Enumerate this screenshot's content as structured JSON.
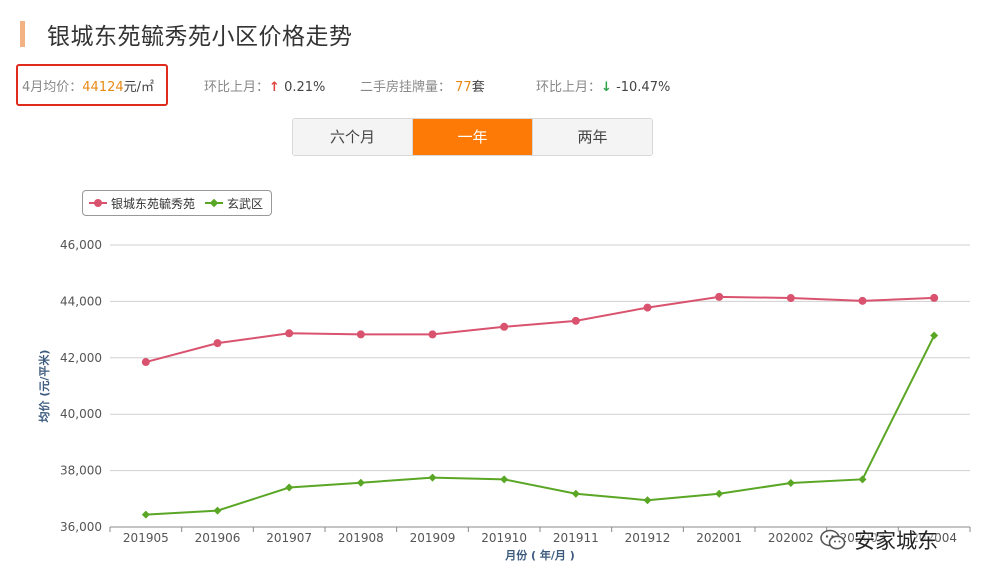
{
  "header": {
    "title": "银城东苑毓秀苑小区价格走势"
  },
  "stats": {
    "avg_label": "4月均价：",
    "avg_value": "44124",
    "avg_unit": "元/㎡",
    "mom_label": "环比上月：",
    "mom_arrow": "↑",
    "mom_value": "0.21%",
    "listings_label": "二手房挂牌量：",
    "listings_value": "77",
    "listings_unit": "套",
    "mom2_label": "环比上月：",
    "mom2_arrow": "↓",
    "mom2_value": "-10.47%"
  },
  "tabs": [
    {
      "label": "六个月",
      "active": false
    },
    {
      "label": "一年",
      "active": true
    },
    {
      "label": "两年",
      "active": false
    }
  ],
  "colors": {
    "accent": "#fe7a06",
    "series1": "#d9536f",
    "series2": "#5aa625",
    "highlight_border": "#e02a1e"
  },
  "watermark": {
    "text": "安家城东",
    "icon": "wechat-icon"
  },
  "chart_data": {
    "type": "line",
    "x": [
      "201905",
      "201906",
      "201907",
      "201908",
      "201909",
      "201910",
      "201911",
      "201912",
      "202001",
      "202002",
      "202003",
      "202004"
    ],
    "xtick_labels": [
      "201905",
      "201906",
      "201907",
      "201908",
      "201909",
      "201910",
      "201911",
      "201912",
      "202001",
      "202002",
      "202003",
      "202004"
    ],
    "series": [
      {
        "name": "银城东苑毓秀苑",
        "values": [
          41850,
          42520,
          42870,
          42830,
          42830,
          43100,
          43310,
          43780,
          44160,
          44120,
          44020,
          44124
        ],
        "marker": "circle"
      },
      {
        "name": "玄武区",
        "values": [
          36440,
          36580,
          37400,
          37570,
          37750,
          37690,
          37180,
          36950,
          37180,
          37560,
          37690,
          42790
        ],
        "marker": "diamond"
      }
    ],
    "ylim": [
      36000,
      46000
    ],
    "yticks": [
      36000,
      38000,
      40000,
      42000,
      44000,
      46000
    ],
    "ytick_labels": [
      "36,000",
      "38,000",
      "40,000",
      "42,000",
      "44,000",
      "46,000"
    ],
    "ylabel": "均价 (元/平米)",
    "xlabel": "月份 ( 年/月 )",
    "grid": true,
    "legend": "top-left"
  }
}
